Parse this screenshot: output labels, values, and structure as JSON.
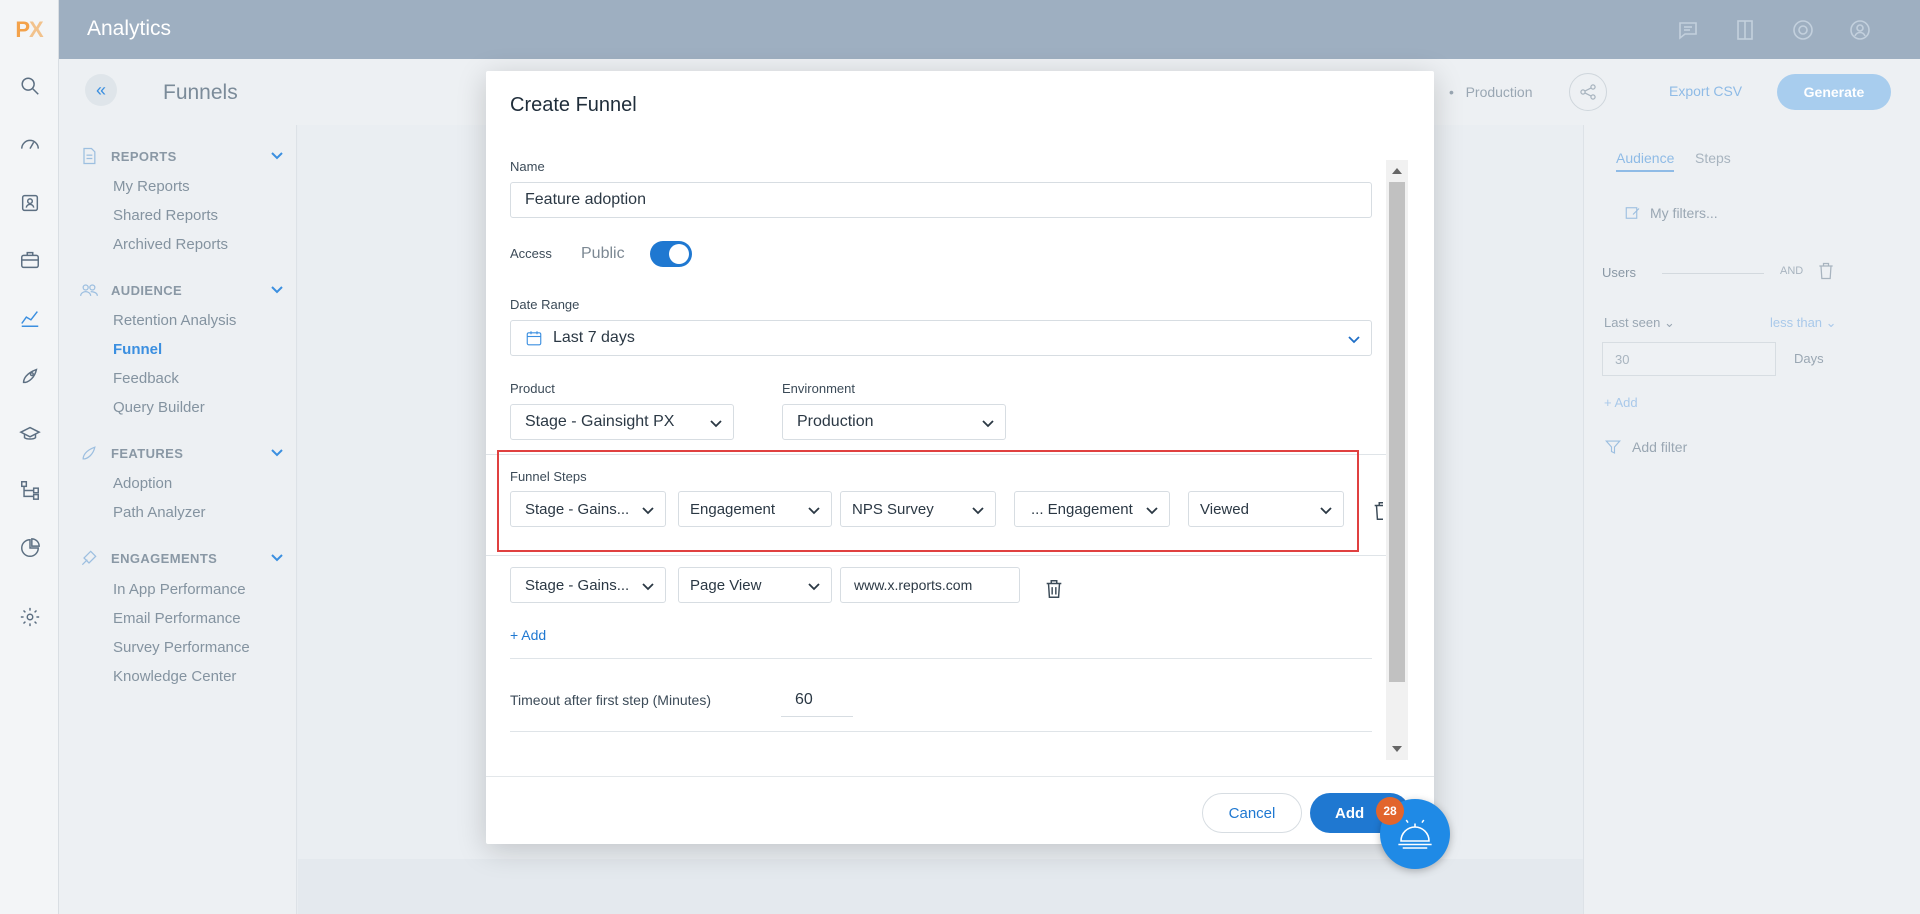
{
  "app": {
    "logo_p": "P",
    "logo_x": "X",
    "title": "Analytics"
  },
  "subheader": {
    "page_title": "Funnels",
    "environment": "Production",
    "export_label": "Export CSV",
    "generate_label": "Generate"
  },
  "nav": {
    "sections": [
      {
        "title": "REPORTS",
        "items": [
          "My Reports",
          "Shared Reports",
          "Archived Reports"
        ]
      },
      {
        "title": "AUDIENCE",
        "items": [
          "Retention Analysis",
          "Funnel",
          "Feedback",
          "Query Builder"
        ]
      },
      {
        "title": "FEATURES",
        "items": [
          "Adoption",
          "Path Analyzer"
        ]
      },
      {
        "title": "ENGAGEMENTS",
        "items": [
          "In App Performance",
          "Email Performance",
          "Survey Performance",
          "Knowledge Center"
        ]
      }
    ],
    "active_item": "Funnel"
  },
  "right_panel": {
    "tabs": [
      "Audience",
      "Steps"
    ],
    "my_filters": "My filters...",
    "users_label": "Users",
    "and_label": "AND",
    "last_seen": "Last seen",
    "less_than": "less than",
    "days_value": "30",
    "days_label": "Days",
    "add_label": "+ Add",
    "add_filter": "Add filter"
  },
  "modal": {
    "title": "Create Funnel",
    "name_label": "Name",
    "name_value": "Feature adoption",
    "access_label": "Access",
    "access_value": "Public",
    "access_on": true,
    "date_range_label": "Date Range",
    "date_range_value": "Last 7 days",
    "product_label": "Product",
    "product_value": "Stage - Gainsight PX",
    "environment_label": "Environment",
    "environment_value": "Production",
    "funnel_steps_label": "Funnel Steps",
    "steps": [
      {
        "product": "Stage - Gains...",
        "type": "Engagement",
        "name": "NPS Survey",
        "sub": "... Engagement",
        "event": "Viewed"
      },
      {
        "product": "Stage - Gains...",
        "type": "Page View",
        "url": "www.x.reports.com"
      }
    ],
    "add_step_label": "+ Add",
    "timeout_label": "Timeout after first step (Minutes)",
    "timeout_value": "60",
    "cancel_label": "Cancel",
    "add_label": "Add"
  },
  "notification_badge": "28",
  "colors": {
    "accent": "#1f78d1",
    "highlight": "#e04040",
    "header": "#9eafc1",
    "badge": "#e2652c"
  }
}
